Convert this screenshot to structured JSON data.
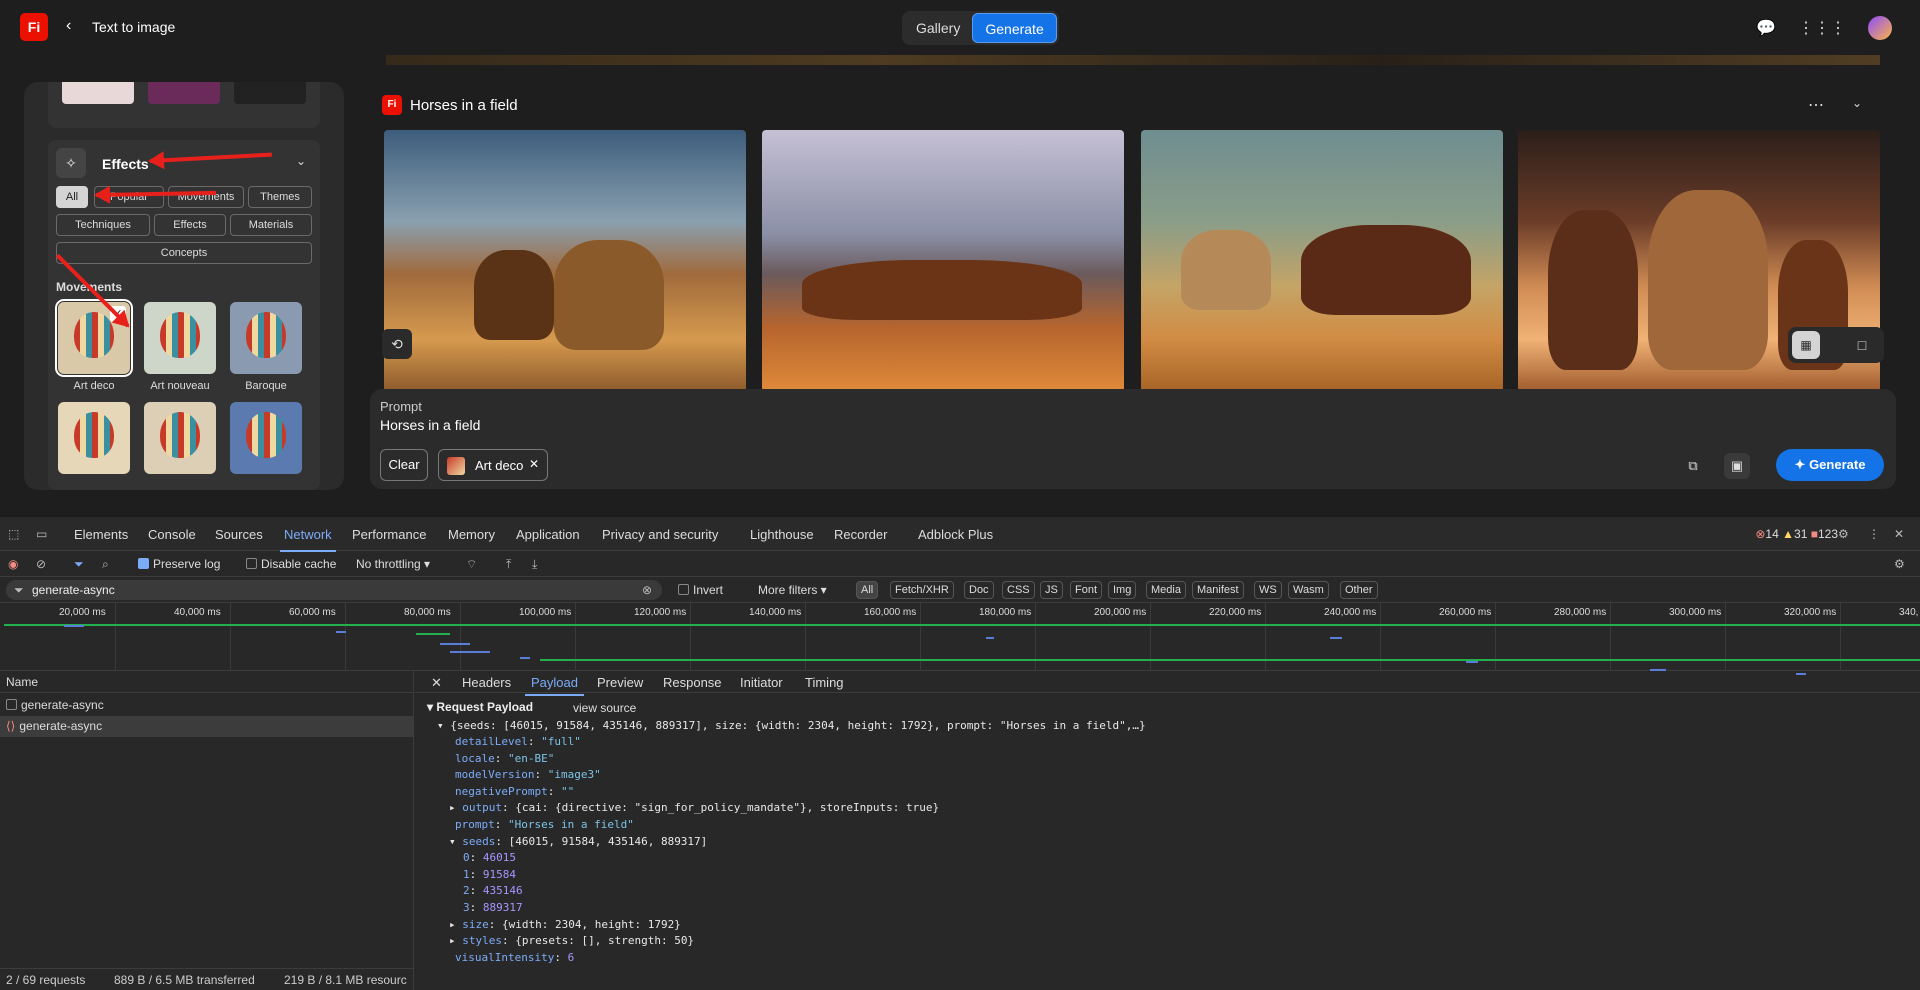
{
  "app": {
    "logo": "Fi",
    "back_icon": "chevron-left-icon",
    "title": "Text to image",
    "modes": [
      "Gallery",
      "Generate"
    ],
    "active_mode": "Generate"
  },
  "effects": {
    "title": "Effects",
    "filters_row1": [
      "All",
      "Popular",
      "Movements",
      "Themes"
    ],
    "filters_row2": [
      "Techniques",
      "Effects",
      "Materials"
    ],
    "filters_row3": [
      "Concepts"
    ],
    "active_filter": "All",
    "section": "Movements",
    "styles": [
      "Art deco",
      "Art nouveau",
      "Baroque"
    ]
  },
  "generation": {
    "title": "Horses in a field",
    "prompt_label": "Prompt",
    "prompt": "Horses in a field",
    "clear_label": "Clear",
    "tag": "Art deco",
    "generate_label": "Generate"
  },
  "devtools": {
    "tabs": [
      "Elements",
      "Console",
      "Sources",
      "Network",
      "Performance",
      "Memory",
      "Application",
      "Privacy and security",
      "Lighthouse",
      "Recorder",
      "Adblock Plus"
    ],
    "active_tab": "Network",
    "errors": "14",
    "warnings": "31",
    "issues": "123",
    "preserve_log": "Preserve log",
    "disable_cache": "Disable cache",
    "throttling": "No throttling",
    "filter": "generate-async",
    "invert": "Invert",
    "more_filters": "More filters",
    "type_filters": [
      "All",
      "Fetch/XHR",
      "Doc",
      "CSS",
      "JS",
      "Font",
      "Img",
      "Media",
      "Manifest",
      "WS",
      "Wasm",
      "Other"
    ],
    "ticks": [
      "20,000 ms",
      "40,000 ms",
      "60,000 ms",
      "80,000 ms",
      "100,000 ms",
      "120,000 ms",
      "140,000 ms",
      "160,000 ms",
      "180,000 ms",
      "200,000 ms",
      "220,000 ms",
      "240,000 ms",
      "260,000 ms",
      "280,000 ms",
      "300,000 ms",
      "320,000 ms",
      "340,"
    ],
    "name_header": "Name",
    "requests": [
      "generate-async",
      "generate-async"
    ],
    "status": {
      "requests": "2 / 69 requests",
      "transferred": "889 B / 6.5 MB transferred",
      "resources": "219 B / 8.1 MB resourc"
    },
    "detail_tabs": [
      "Headers",
      "Payload",
      "Preview",
      "Response",
      "Initiator",
      "Timing"
    ],
    "active_detail_tab": "Payload",
    "payload_title": "Request Payload",
    "view_source": "view source",
    "payload_summary": "{seeds: [46015, 91584, 435146, 889317], size: {width: 2304, height: 1792}, prompt: \"Horses in a field\",…}",
    "payload": [
      {
        "key": "detailLevel",
        "value": "\"full\"",
        "kind": "s"
      },
      {
        "key": "locale",
        "value": "\"en-BE\"",
        "kind": "s"
      },
      {
        "key": "modelVersion",
        "value": "\"image3\"",
        "kind": "s"
      },
      {
        "key": "negativePrompt",
        "value": "\"\"",
        "kind": "s"
      },
      {
        "key": "output",
        "value": "{cai: {directive: \"sign_for_policy_mandate\"}, storeInputs: true}",
        "kind": "o",
        "collapsed": true
      },
      {
        "key": "prompt",
        "value": "\"Horses in a field\"",
        "kind": "s"
      },
      {
        "key": "seeds",
        "value": "[46015, 91584, 435146, 889317]",
        "kind": "o",
        "expanded": true
      },
      {
        "key": "0",
        "value": "46015",
        "kind": "n",
        "indent": true
      },
      {
        "key": "1",
        "value": "91584",
        "kind": "n",
        "indent": true
      },
      {
        "key": "2",
        "value": "435146",
        "kind": "n",
        "indent": true
      },
      {
        "key": "3",
        "value": "889317",
        "kind": "n",
        "indent": true
      },
      {
        "key": "size",
        "value": "{width: 2304, height: 1792}",
        "kind": "o",
        "collapsed": true
      },
      {
        "key": "styles",
        "value": "{presets: [], strength: 50}",
        "kind": "o",
        "collapsed": true
      },
      {
        "key": "visualIntensity",
        "value": "6",
        "kind": "n"
      }
    ]
  }
}
